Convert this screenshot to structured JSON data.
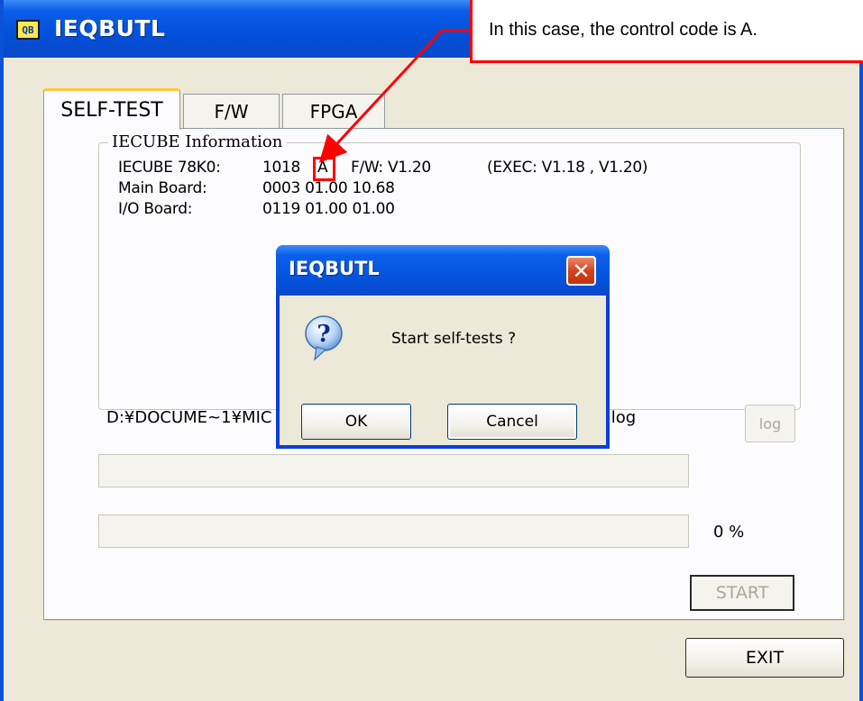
{
  "window": {
    "title": "IEQBUTL",
    "icon_text": "QB"
  },
  "tabs": [
    {
      "label": "SELF-TEST",
      "active": true
    },
    {
      "label": "F/W",
      "active": false
    },
    {
      "label": "FPGA",
      "active": false
    }
  ],
  "info": {
    "group_label": "IECUBE Information",
    "rows": [
      {
        "label": "IECUBE 78K0:",
        "value": "1018",
        "control_code": "A",
        "fw": "F/W: V1.20",
        "exec": "(EXEC: V1.18 , V1.20)"
      },
      {
        "label": "Main Board:",
        "value": "0003 01.00 10.68"
      },
      {
        "label": "I/O Board:",
        "value": "0119 01.00 01.00"
      }
    ]
  },
  "log": {
    "path_left": "D:¥DOCUME~1¥MIC",
    "path_right": ".log",
    "button_label": "log"
  },
  "progress": {
    "percent_label": "0 %",
    "value": 0
  },
  "buttons": {
    "start_label": "START",
    "exit_label": "EXIT"
  },
  "callout": {
    "text": "In this case, the control code is A."
  },
  "dialog": {
    "title": "IEQBUTL",
    "close_glyph": "✕",
    "message": "Start self-tests ?",
    "ok_label": "OK",
    "cancel_label": "Cancel"
  },
  "colors": {
    "annotation": "#ff0000",
    "titlebar": "#0350da",
    "dialog_background": "#ece9d8"
  },
  "icons": [
    "app-icon",
    "question-icon",
    "close-icon"
  ]
}
